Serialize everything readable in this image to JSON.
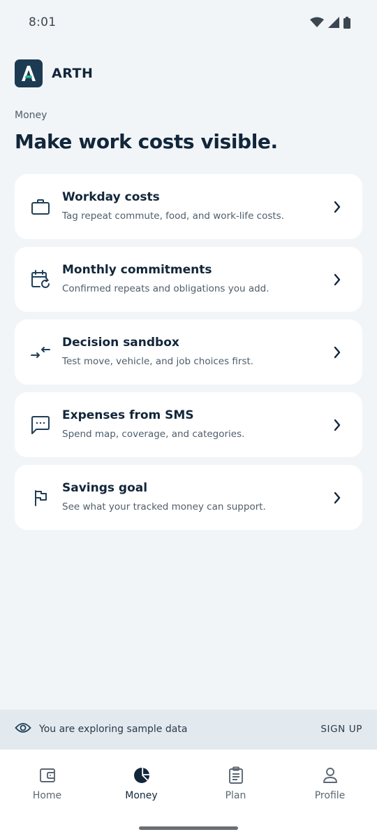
{
  "status_bar": {
    "time": "8:01",
    "icons": [
      "wifi-icon",
      "signal-icon",
      "battery-icon"
    ]
  },
  "brand": {
    "name": "ARTH",
    "logo_icon": "arth-logo-icon"
  },
  "page": {
    "section_label": "Money",
    "title": "Make work costs visible."
  },
  "cards": [
    {
      "icon": "briefcase-icon",
      "title": "Workday costs",
      "subtitle": "Tag repeat commute, food, and work-life costs."
    },
    {
      "icon": "calendar-repeat-icon",
      "title": "Monthly commitments",
      "subtitle": "Confirmed repeats and obligations you add."
    },
    {
      "icon": "swap-arrows-icon",
      "title": "Decision sandbox",
      "subtitle": "Test move, vehicle, and job choices first."
    },
    {
      "icon": "message-dots-icon",
      "title": "Expenses from SMS",
      "subtitle": "Spend map, coverage, and categories."
    },
    {
      "icon": "flag-icon",
      "title": "Savings goal",
      "subtitle": "See what your tracked money can support."
    }
  ],
  "sample_banner": {
    "icon": "eye-icon",
    "text": "You are exploring sample data",
    "action": "SIGN UP"
  },
  "bottom_nav": {
    "items": [
      {
        "icon": "wallet-icon",
        "label": "Home",
        "active": false
      },
      {
        "icon": "pie-chart-icon",
        "label": "Money",
        "active": true
      },
      {
        "icon": "clipboard-icon",
        "label": "Plan",
        "active": false
      },
      {
        "icon": "person-icon",
        "label": "Profile",
        "active": false
      }
    ]
  },
  "colors": {
    "background": "#f1f5f8",
    "card": "#ffffff",
    "text_primary": "#12263a",
    "text_secondary": "#4f5d6a",
    "brand_logo_bg": "#1c3a52",
    "banner_bg": "#e3eaef"
  }
}
